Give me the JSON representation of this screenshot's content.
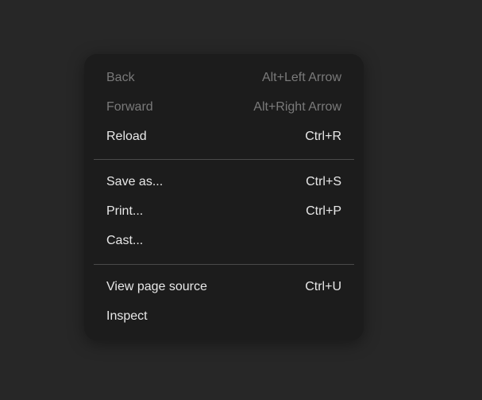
{
  "menu": {
    "groups": [
      [
        {
          "label": "Back",
          "shortcut": "Alt+Left Arrow",
          "disabled": true
        },
        {
          "label": "Forward",
          "shortcut": "Alt+Right Arrow",
          "disabled": true
        },
        {
          "label": "Reload",
          "shortcut": "Ctrl+R",
          "disabled": false
        }
      ],
      [
        {
          "label": "Save as...",
          "shortcut": "Ctrl+S",
          "disabled": false
        },
        {
          "label": "Print...",
          "shortcut": "Ctrl+P",
          "disabled": false
        },
        {
          "label": "Cast...",
          "shortcut": "",
          "disabled": false
        }
      ],
      [
        {
          "label": "View page source",
          "shortcut": "Ctrl+U",
          "disabled": false
        },
        {
          "label": "Inspect",
          "shortcut": "",
          "disabled": false
        }
      ]
    ]
  }
}
